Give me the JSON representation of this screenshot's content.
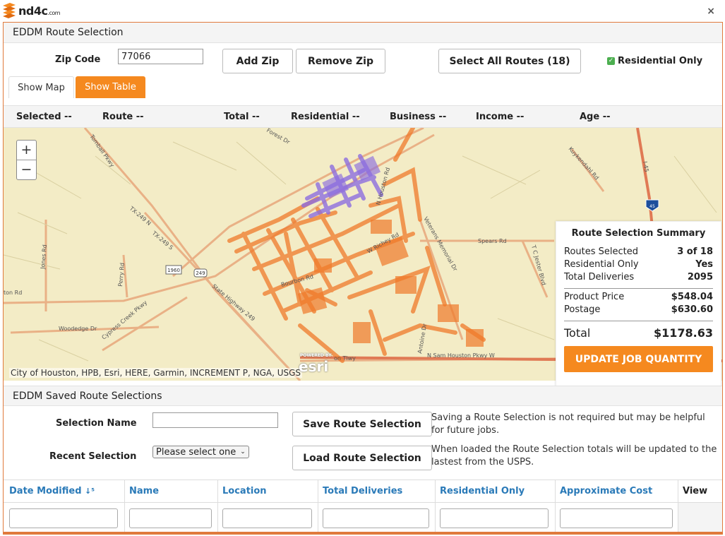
{
  "brand": {
    "logo_text": "nd4c",
    "logo_com": ".com"
  },
  "header": {
    "close_label": "×"
  },
  "route_selection": {
    "title": "EDDM Route Selection",
    "zip_label": "Zip Code",
    "zip_value": "77066",
    "add_zip": "Add Zip",
    "remove_zip": "Remove Zip",
    "select_all": "Select All Routes (18)",
    "residential_only_label": "Residential Only",
    "residential_only_checked": true,
    "tabs": [
      {
        "label": "Show Map",
        "active": false
      },
      {
        "label": "Show Table",
        "active": true
      }
    ],
    "columns": [
      "Selected  --",
      "Route  --",
      "Total  --",
      "Residential  --",
      "Business  --",
      "Income  --",
      "Age  --"
    ]
  },
  "map": {
    "zoom_in": "+",
    "zoom_out": "−",
    "attribution": "City of Houston, HPB, Esri, HERE, Garmin, INCREMENT P, NGA, USGS",
    "powered_by": "POWERED BY",
    "esri": "esri",
    "street_labels": [
      "Tomball Pkwy",
      "TX-249 N",
      "TX-249 S",
      "Perry Rd",
      "Jones Rd",
      "Cypress Creek Pkwy",
      "Woodedge Dr",
      "State Highway 249",
      "1960",
      "249",
      "Bourbon Rd",
      "W Richey Rd",
      "N Houston Rd",
      "Veterans Memorial Dr",
      "Spears Rd",
      "T C Jester Blvd",
      "Kuykendahl Rd",
      "I-45",
      "45",
      "Antoine Dr",
      "N Sam Houston Pkwy W",
      "on Tlwy",
      "Forest Dr",
      "ton Rd"
    ],
    "colors": {
      "land": "#f3ecc6",
      "major_road": "#e8a77c",
      "route_orange": "#f07a2a",
      "route_purple": "#8d6ee0",
      "highway": "#e07a55"
    }
  },
  "summary": {
    "title": "Route Selection Summary",
    "rows": [
      {
        "label": "Routes Selected",
        "value": "3 of 18"
      },
      {
        "label": "Residential Only",
        "value": "Yes"
      },
      {
        "label": "Total Deliveries",
        "value": "2095"
      }
    ],
    "price_rows": [
      {
        "label": "Product Price",
        "value": "$548.04"
      },
      {
        "label": "Postage",
        "value": "$630.60"
      }
    ],
    "total_label": "Total",
    "total_value": "$1178.63",
    "update_button": "UPDATE JOB QUANTITY"
  },
  "saved": {
    "title": "EDDM Saved Route Selections",
    "selection_name_label": "Selection Name",
    "selection_name_value": "",
    "recent_label": "Recent Selection",
    "recent_value": "Please select one",
    "save_button": "Save Route Selection",
    "load_button": "Load Route Selection",
    "save_help": "Saving a Route Selection is not required but may be helpful for future jobs.",
    "load_help": "When loaded the Route Selection totals will be updated to the lastest from the USPS.",
    "grid_columns": [
      "Date Modified",
      "Name",
      "Location",
      "Total Deliveries",
      "Residential Only",
      "Approximate Cost",
      "View"
    ],
    "sort_icon": "sort-ascending-icon"
  }
}
